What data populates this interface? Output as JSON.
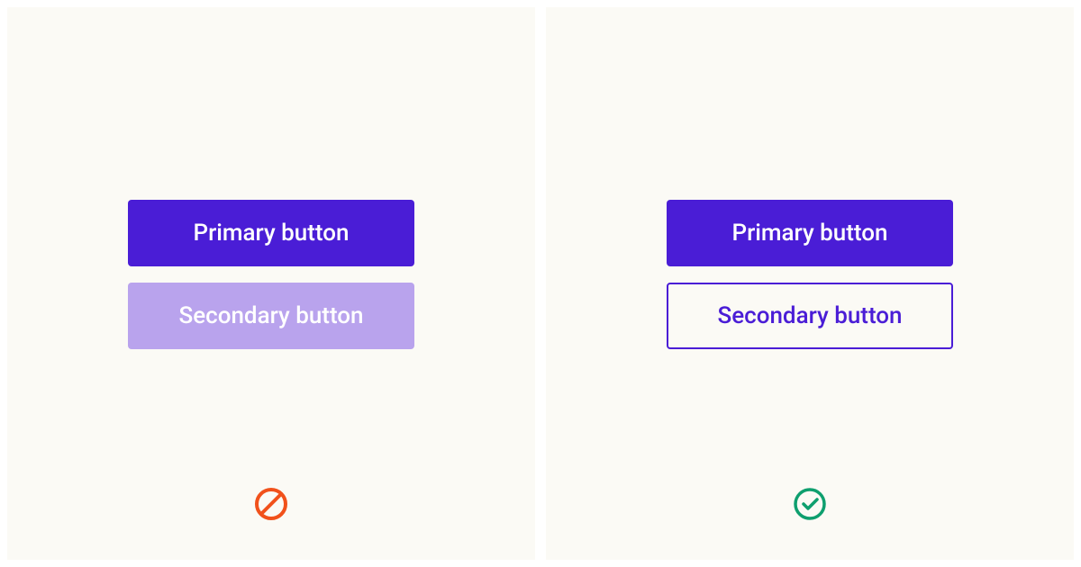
{
  "panels": {
    "dont": {
      "primary_label": "Primary button",
      "secondary_label": "Secondary button",
      "status": "dont"
    },
    "do": {
      "primary_label": "Primary button",
      "secondary_label": "Secondary button",
      "status": "do"
    }
  },
  "colors": {
    "primary": "#4a1dd6",
    "secondary_bad_bg": "#b9a3ed",
    "panel_bg": "#fbfaf5",
    "dont_icon": "#f1511b",
    "do_icon": "#0e9f6e"
  }
}
